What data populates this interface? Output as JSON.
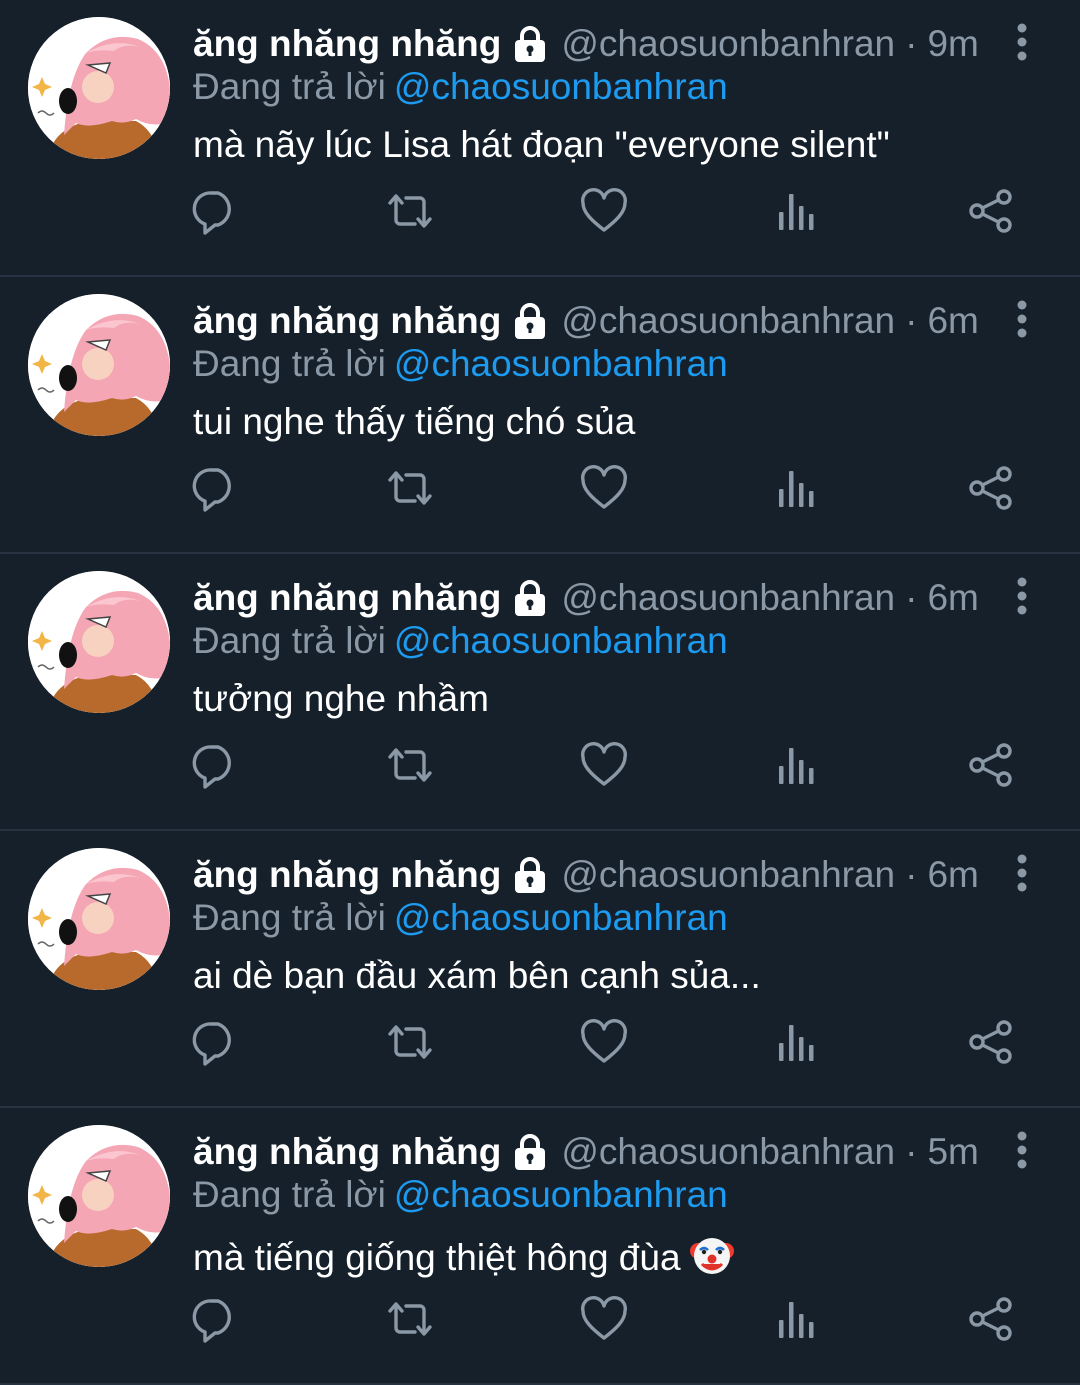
{
  "tweets": [
    {
      "name": "ăng nhăng nhăng",
      "handle": "@chaosuonbanhran",
      "separator": "·",
      "time": "9m",
      "reply_prefix": "Đang trả lời",
      "reply_to": "@chaosuonbanhran",
      "text": "mà nãy lúc Lisa hát đoạn \"everyone silent\"",
      "emoji": ""
    },
    {
      "name": "ăng nhăng nhăng",
      "handle": "@chaosuonbanhran",
      "separator": "·",
      "time": "6m",
      "reply_prefix": "Đang trả lời",
      "reply_to": "@chaosuonbanhran",
      "text": "tui nghe thấy tiếng chó sủa",
      "emoji": ""
    },
    {
      "name": "ăng nhăng nhăng",
      "handle": "@chaosuonbanhran",
      "separator": "·",
      "time": "6m",
      "reply_prefix": "Đang trả lời",
      "reply_to": "@chaosuonbanhran",
      "text": "tưởng nghe nhầm",
      "emoji": ""
    },
    {
      "name": "ăng nhăng nhăng",
      "handle": "@chaosuonbanhran",
      "separator": "·",
      "time": "6m",
      "reply_prefix": "Đang trả lời",
      "reply_to": "@chaosuonbanhran",
      "text": "ai dè bạn đầu xám bên cạnh sủa...",
      "emoji": ""
    },
    {
      "name": "ăng nhăng nhăng",
      "handle": "@chaosuonbanhran",
      "separator": "·",
      "time": "5m",
      "reply_prefix": "Đang trả lời",
      "reply_to": "@chaosuonbanhran",
      "text": "mà tiếng giống thiệt hông đùa",
      "emoji": "clown-face-emoji"
    }
  ],
  "icons": {
    "lock": "lock-icon",
    "more": "more-vertical-icon",
    "reply": "reply-icon",
    "retweet": "retweet-icon",
    "like": "heart-icon",
    "analytics": "analytics-icon",
    "share": "share-icon"
  },
  "colors": {
    "background": "#15202b",
    "divider": "#273340",
    "secondary_text": "#8b98a5",
    "mention": "#1d9bf0",
    "icon": "#8b98a5"
  }
}
